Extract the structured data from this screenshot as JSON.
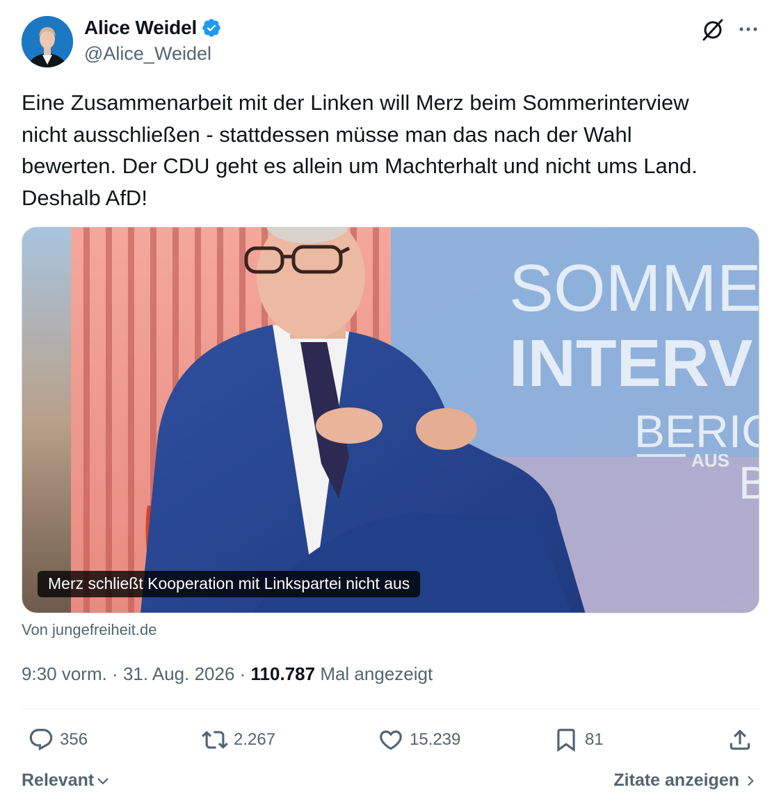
{
  "author": {
    "display_name": "Alice Weidel",
    "handle": "@Alice_Weidel",
    "verified": true,
    "verified_color": "#1d9bf0"
  },
  "header_icons": [
    "grok-icon",
    "more-icon"
  ],
  "tweet": {
    "text_lines": [
      "Eine Zusammenarbeit mit der Linken will Merz beim Sommerinterview",
      "nicht ausschließen - stattdessen müsse man das nach der Wahl",
      "bewerten. Der CDU geht es allein um Machterhalt und nicht ums Land.",
      "Deshalb AfD!"
    ]
  },
  "media": {
    "caption": "Merz schließt Kooperation mit Linkspartei nicht aus",
    "backdrop_text": {
      "line1": "SOMME",
      "line2": "INTERV",
      "line3": "BERIC",
      "line4": "AUS",
      "line5": "B"
    },
    "source": "Von jungefreiheit.de"
  },
  "meta": {
    "time": "9:30 vorm.",
    "separator": " · ",
    "date": "31. Aug. 2026",
    "views_count": "110.787",
    "views_label": " Mal angezeigt"
  },
  "actions": {
    "replies": "356",
    "reposts": "2.267",
    "likes": "15.239",
    "bookmarks": "81"
  },
  "footer": {
    "sort_label": "Relevant",
    "quotes_label": "Zitate anzeigen"
  },
  "colors": {
    "text_primary": "#0f1419",
    "text_secondary": "#536471",
    "border": "#cfd9de",
    "divider": "#eff3f4"
  }
}
